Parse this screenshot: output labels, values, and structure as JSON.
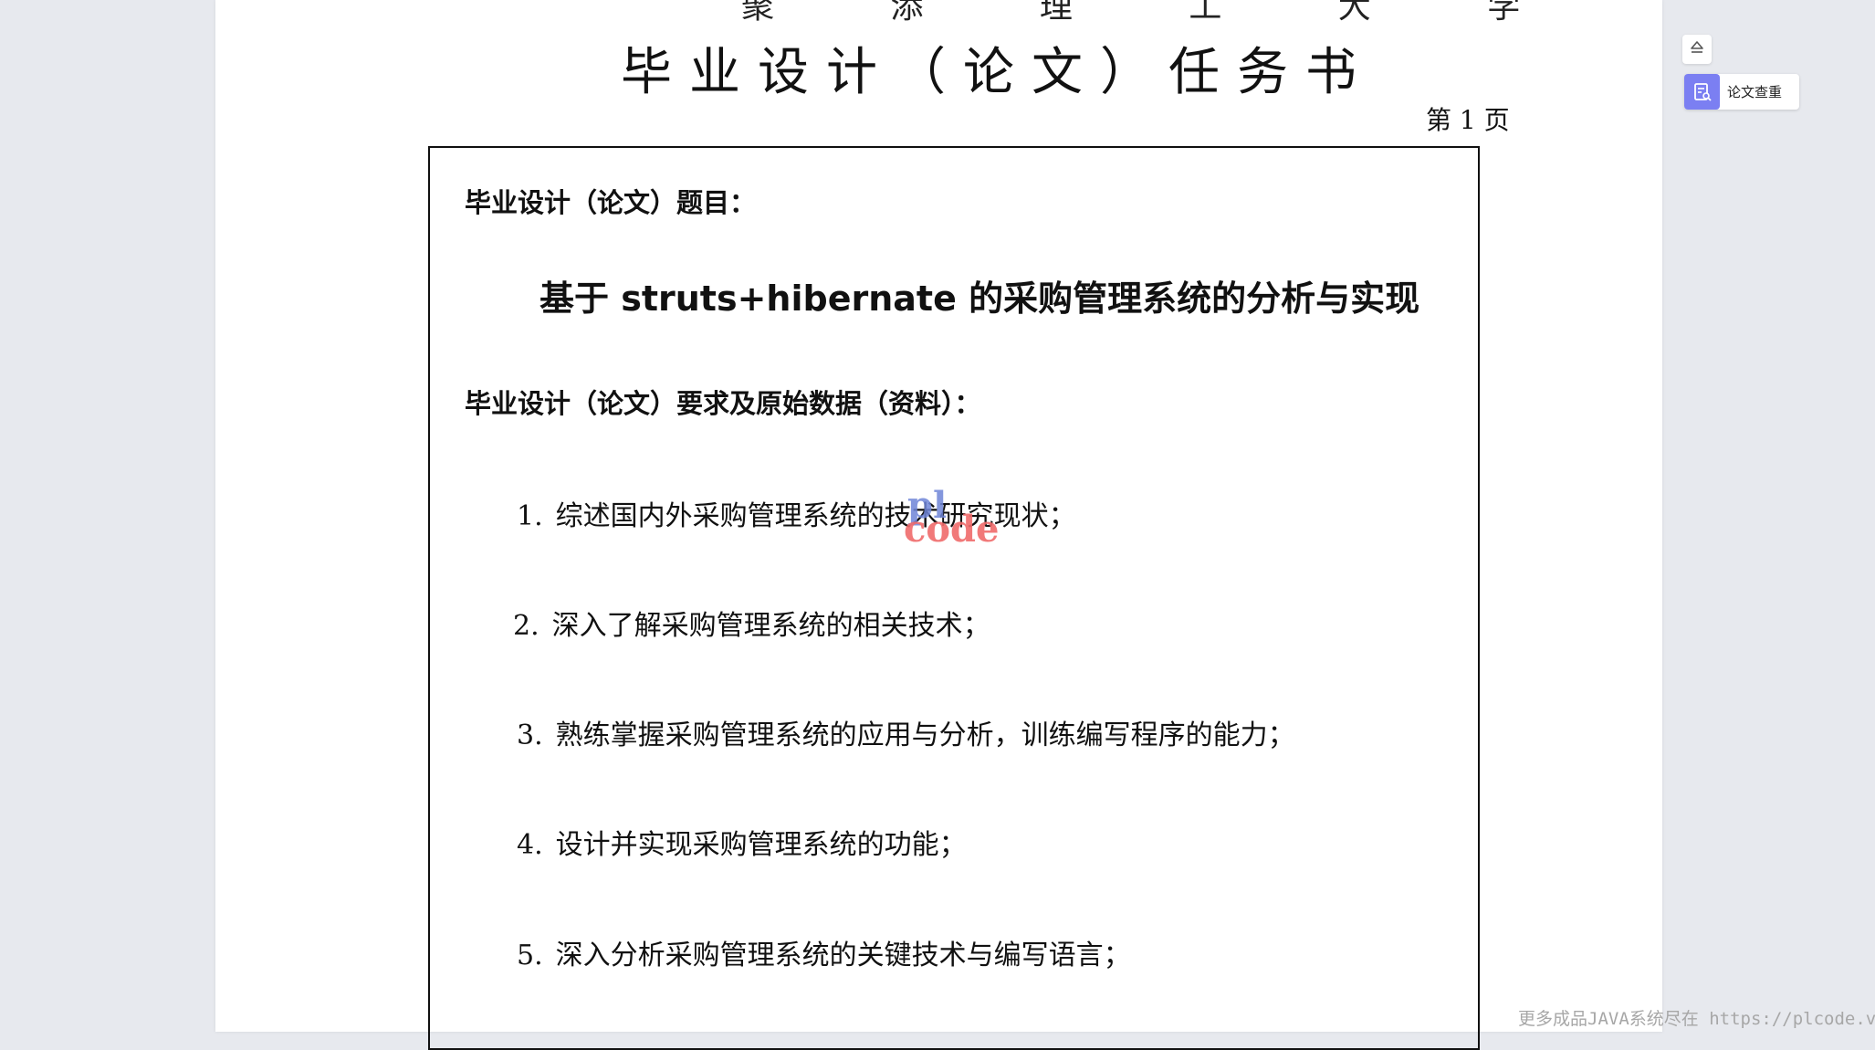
{
  "document": {
    "top_cut_text": "聚 添 理 工 大 学",
    "title": "毕业设计（论文）任务书",
    "page_number": "第 1 页",
    "topic_label": "毕业设计（论文）题目：",
    "topic": "基于 struts+hibernate 的采购管理系统的分析与实现",
    "requirements_label": "毕业设计（论文）要求及原始数据（资料）：",
    "requirements": [
      {
        "num": "1.",
        "text": "综述国内外采购管理系统的技术研究现状；"
      },
      {
        "num": "2.",
        "text": "深入了解采购管理系统的相关技术；"
      },
      {
        "num": "3.",
        "text": "熟练掌握采购管理系统的应用与分析，训练编写程序的能力；"
      },
      {
        "num": "4.",
        "text": "设计并实现采购管理系统的功能；"
      },
      {
        "num": "5.",
        "text": "深入分析采购管理系统的关键技术与编写语言；"
      }
    ]
  },
  "watermark": {
    "logo_top": "pl",
    "logo_bottom": "code",
    "footer": "更多成品JAVA系统尽在 https://plcode.vip"
  },
  "sidebar": {
    "collapse_icon": "eject-icon",
    "check_icon": "document-check-icon",
    "check_label": "论文查重",
    "accent_color": "#7b7ff2"
  }
}
